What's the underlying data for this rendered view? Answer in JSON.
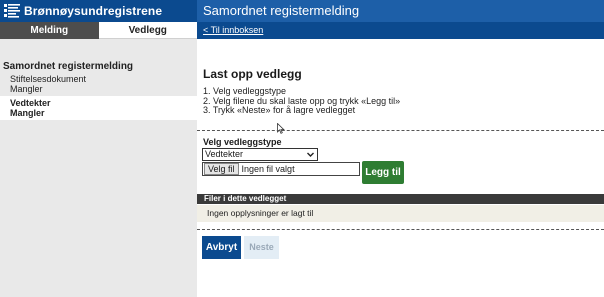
{
  "header": {
    "logo_text": "Brønnøysundregistrene",
    "page_title": "Samordnet registermelding"
  },
  "tabs": [
    {
      "label": "Melding",
      "active": false
    },
    {
      "label": "Vedlegg",
      "active": true
    }
  ],
  "breadcrumb": {
    "link_text": "< Til innboksen"
  },
  "sidebar": {
    "title": "Samordnet registermelding",
    "items": [
      {
        "name": "Stiftelsesdokument",
        "status": "Mangler"
      },
      {
        "name": "Vedtekter",
        "status": "Mangler"
      }
    ]
  },
  "main": {
    "heading": "Last opp vedlegg",
    "steps": [
      "1. Velg vedleggstype",
      "2. Velg filene du skal laste opp og trykk «Legg til»",
      "3. Trykk «Neste» for å lagre vedlegget"
    ],
    "select_label": "Velg vedleggstype",
    "select_value": "Vedtekter",
    "file_button": "Velg fil",
    "file_status": "Ingen fil valgt",
    "add_button": "Legg til",
    "files_header": "Filer i dette vedlegget",
    "files_empty": "Ingen opplysninger er lagt til",
    "cancel_button": "Avbryt",
    "next_button": "Neste"
  },
  "colors": {
    "brand_dark": "#0b4a8f",
    "brand_light": "#1d5fa8",
    "add_green": "#2e7d32",
    "disabled_bg": "#e3edf5"
  }
}
